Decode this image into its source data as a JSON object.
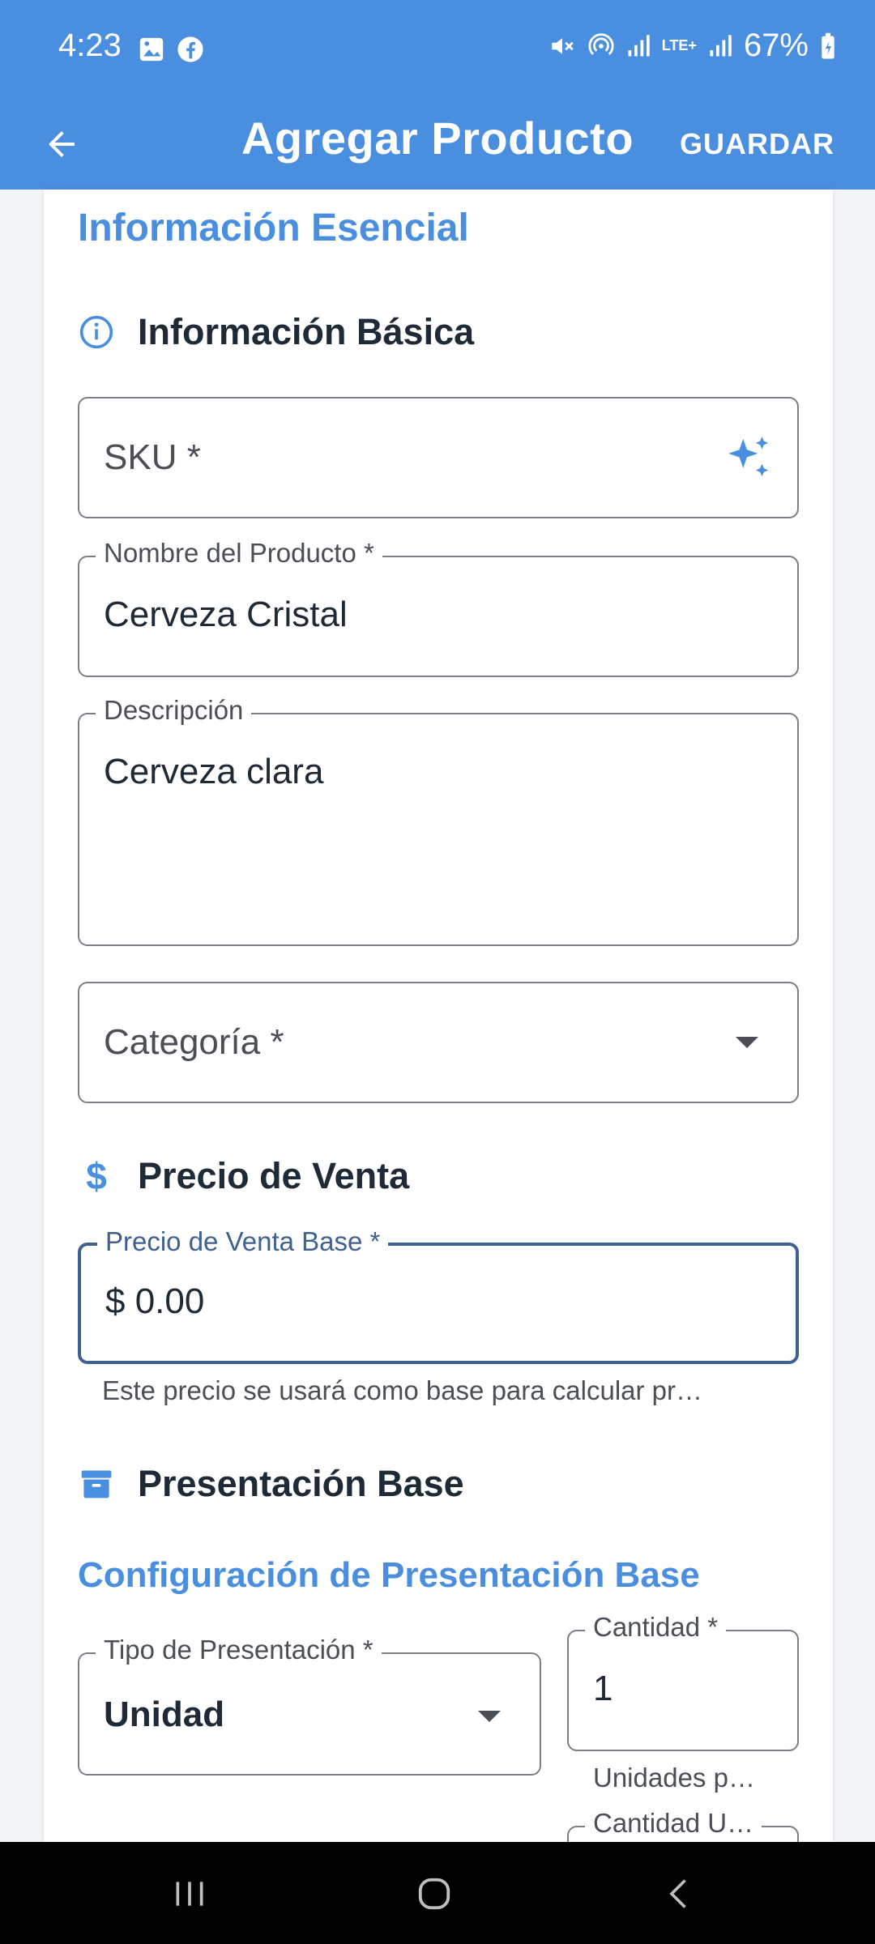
{
  "status_bar": {
    "time": "4:23",
    "battery": "67%",
    "network": "LTE+"
  },
  "app_bar": {
    "title": "Agregar Producto",
    "save_label": "GUARDAR"
  },
  "section": {
    "title": "Información Esencial"
  },
  "basic_info": {
    "heading": "Información Básica",
    "sku_label": "SKU *",
    "name_label": "Nombre del Producto *",
    "name_value": "Cerveza Cristal",
    "description_label": "Descripción",
    "description_value": "Cerveza clara",
    "category_label": "Categoría *"
  },
  "price": {
    "heading": "Precio de Venta",
    "base_price_label": "Precio de Venta Base *",
    "base_price_value": "$ 0.00",
    "helper": "Este precio se usará como base para calcular pr…"
  },
  "presentation": {
    "heading": "Presentación Base",
    "config_title": "Configuración de Presentación Base",
    "type_label": "Tipo de Presentación *",
    "type_value": "Unidad",
    "quantity_label": "Cantidad *",
    "quantity_value": "1",
    "quantity_helper": "Unidades p…",
    "unit_quantity_label": "Cantidad U…"
  },
  "colors": {
    "primary": "#4a8fdf",
    "focused_border": "#3f6190",
    "text": "#1f2a37"
  },
  "icons": {
    "back": "arrow-left-icon",
    "sku": "sparkle-icon",
    "basic_info": "info-circle-icon",
    "price": "dollar-icon",
    "presentation": "archive-box-icon"
  }
}
